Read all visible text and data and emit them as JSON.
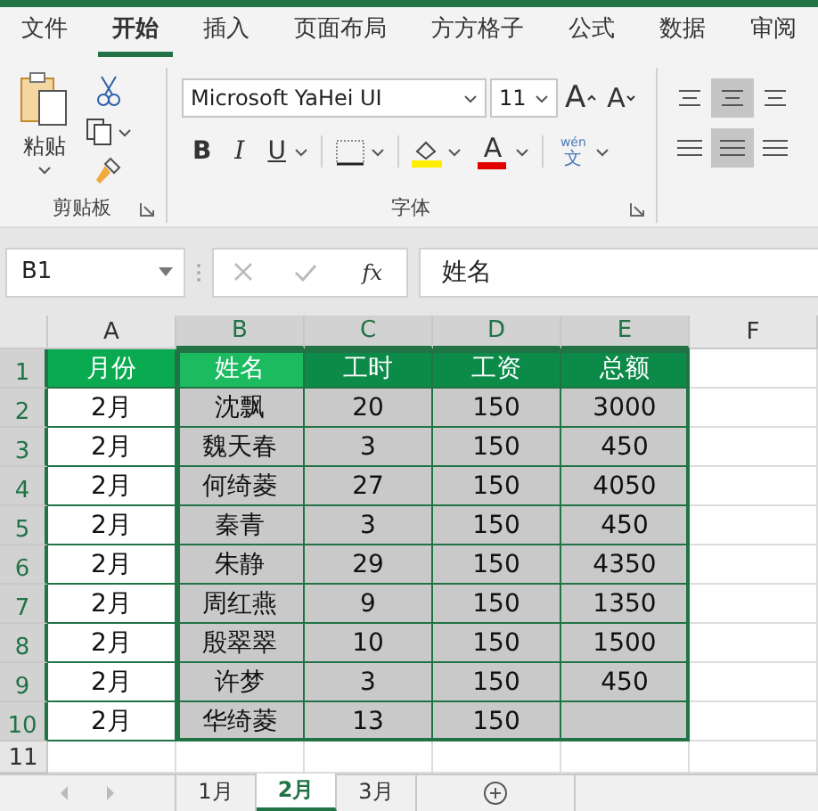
{
  "ribbon_tabs": [
    {
      "label": "文件",
      "selected": false
    },
    {
      "label": "开始",
      "selected": true
    },
    {
      "label": "插入",
      "selected": false
    },
    {
      "label": "页面布局",
      "selected": false
    },
    {
      "label": "方方格子",
      "selected": false
    },
    {
      "label": "公式",
      "selected": false
    },
    {
      "label": "数据",
      "selected": false
    },
    {
      "label": "审阅",
      "selected": false
    }
  ],
  "clipboard": {
    "paste_label": "粘贴",
    "group_label": "剪贴板"
  },
  "font": {
    "name": "Microsoft YaHei UI",
    "size": "11",
    "grow": "A",
    "shrink": "A",
    "bold": "B",
    "italic": "I",
    "underline": "U",
    "color_letter": "A",
    "phonetic_top": "wén",
    "phonetic_bottom": "文",
    "group_label": "字体"
  },
  "alignment": {
    "top_row": [
      {
        "selected": false
      },
      {
        "selected": true
      },
      {
        "selected": false
      }
    ],
    "bottom_row": [
      {
        "selected": false
      },
      {
        "selected": true
      },
      {
        "selected": false
      }
    ]
  },
  "formula_bar": {
    "name_box": "B1",
    "function_label": "fx",
    "formula": "姓名"
  },
  "sheet": {
    "columns": [
      {
        "label": "A",
        "selected": false
      },
      {
        "label": "B",
        "selected": true
      },
      {
        "label": "C",
        "selected": true
      },
      {
        "label": "D",
        "selected": true
      },
      {
        "label": "E",
        "selected": true
      },
      {
        "label": "F",
        "selected": false
      }
    ],
    "rows": [
      {
        "number": "1",
        "selected": true,
        "kind": "header",
        "cells": [
          {
            "text": "月份",
            "color": "#0aaa50"
          },
          {
            "text": "姓名",
            "color": "#1cbb60"
          },
          {
            "text": "工时",
            "color": "#0b8a48"
          },
          {
            "text": "工资",
            "color": "#0b8a48"
          },
          {
            "text": "总额",
            "color": "#0b8a48"
          }
        ]
      },
      {
        "number": "2",
        "selected": true,
        "kind": "data",
        "cells": [
          "2月",
          "沈飘",
          "20",
          "150",
          "3000"
        ]
      },
      {
        "number": "3",
        "selected": true,
        "kind": "data",
        "cells": [
          "2月",
          "魏天春",
          "3",
          "150",
          "450"
        ]
      },
      {
        "number": "4",
        "selected": true,
        "kind": "data",
        "cells": [
          "2月",
          "何绮菱",
          "27",
          "150",
          "4050"
        ]
      },
      {
        "number": "5",
        "selected": true,
        "kind": "data",
        "cells": [
          "2月",
          "秦青",
          "3",
          "150",
          "450"
        ]
      },
      {
        "number": "6",
        "selected": true,
        "kind": "data",
        "cells": [
          "2月",
          "朱静",
          "29",
          "150",
          "4350"
        ]
      },
      {
        "number": "7",
        "selected": true,
        "kind": "data",
        "cells": [
          "2月",
          "周红燕",
          "9",
          "150",
          "1350"
        ]
      },
      {
        "number": "8",
        "selected": true,
        "kind": "data",
        "cells": [
          "2月",
          "殷翠翠",
          "10",
          "150",
          "1500"
        ]
      },
      {
        "number": "9",
        "selected": true,
        "kind": "data",
        "cells": [
          "2月",
          "许梦",
          "3",
          "150",
          "450"
        ]
      },
      {
        "number": "10",
        "selected": true,
        "kind": "data",
        "cells": [
          "2月",
          "华绮菱",
          "13",
          "150",
          null
        ]
      },
      {
        "number": "11",
        "selected": false,
        "kind": "empty",
        "cells": []
      }
    ]
  },
  "sheet_tabs": [
    {
      "label": "1月",
      "selected": false
    },
    {
      "label": "2月",
      "selected": true
    },
    {
      "label": "3月",
      "selected": false
    }
  ]
}
